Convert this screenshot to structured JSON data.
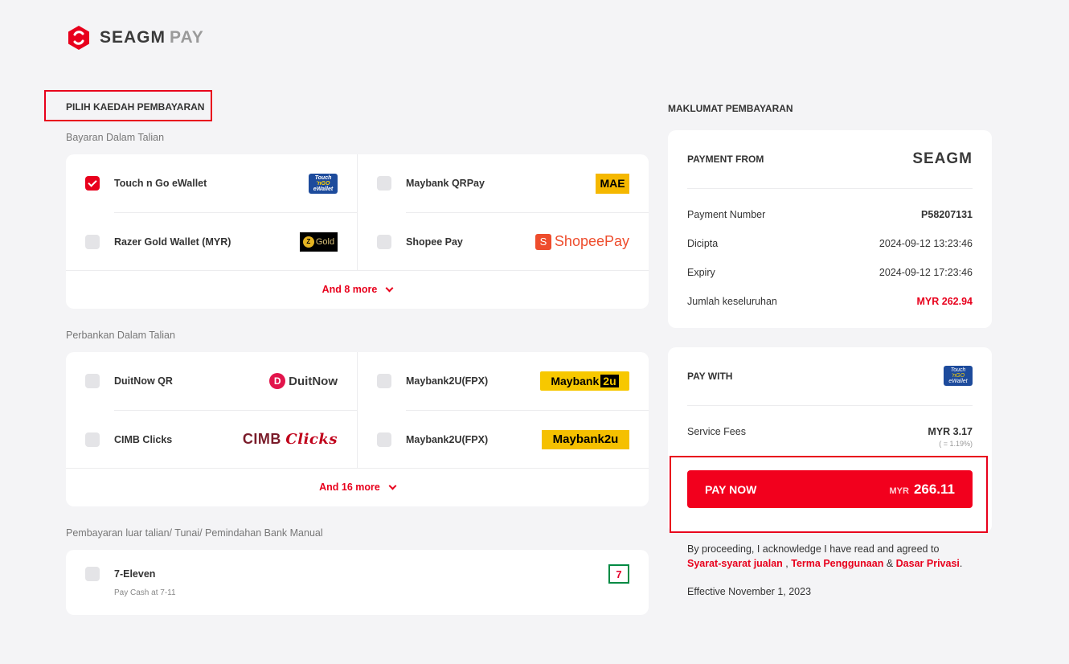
{
  "brand": {
    "name": "SEAGM",
    "suffix": "PAY"
  },
  "left": {
    "title": "PILIH KAEDAH PEMBAYARAN",
    "groups": [
      {
        "label": "Bayaran Dalam Talian",
        "options": [
          {
            "label": "Touch n Go eWallet",
            "checked": true
          },
          {
            "label": "Maybank QRPay",
            "checked": false
          },
          {
            "label": "Razer Gold Wallet (MYR)",
            "checked": false
          },
          {
            "label": "Shopee Pay",
            "checked": false
          }
        ],
        "more": "And 8 more"
      },
      {
        "label": "Perbankan Dalam Talian",
        "options": [
          {
            "label": "DuitNow QR",
            "checked": false
          },
          {
            "label": "Maybank2U(FPX)",
            "checked": false
          },
          {
            "label": "CIMB Clicks",
            "checked": false
          },
          {
            "label": "Maybank2U(FPX)",
            "checked": false
          }
        ],
        "more": "And 16 more"
      },
      {
        "label": "Pembayaran luar talian/ Tunai/ Pemindahan Bank Manual",
        "options": [
          {
            "label": "7-Eleven",
            "sub": "Pay Cash at 7-11",
            "checked": false
          }
        ]
      }
    ],
    "logos": {
      "tng_top": "Touch",
      "tng_mid": "'nGO",
      "tng_bot": "eWallet",
      "razer_coin": "Z",
      "razer_text": "Gold",
      "mae": "MAE",
      "shopee_bag": "S",
      "shopee_text": "ShopeePay",
      "duitnow_d": "D",
      "duitnow_text": "DuitNow",
      "mb2u_a": "Maybank",
      "mb2u_b": "2u",
      "cimb_a": "CIMB",
      "cimb_b": "Clicks",
      "mb2u_plain": "Maybank2u",
      "seven": "7"
    }
  },
  "right": {
    "title": "MAKLUMAT PEMBAYARAN",
    "payment_from": {
      "label": "PAYMENT FROM",
      "merchant": "SEAGM",
      "rows": [
        {
          "label": "Payment Number",
          "value": "P58207131"
        },
        {
          "label": "Dicipta",
          "value": "2024-09-12 13:23:46"
        },
        {
          "label": "Expiry",
          "value": "2024-09-12 17:23:46"
        },
        {
          "label": "Jumlah keseluruhan",
          "value": "MYR 262.94"
        }
      ]
    },
    "pay_with": {
      "label": "PAY WITH",
      "fee_label": "Service Fees",
      "fee_value": "MYR 3.17",
      "fee_pct": "( = 1.19%)"
    },
    "pay_button": {
      "label": "PAY NOW",
      "currency": "MYR",
      "amount": "266.11"
    },
    "legal": {
      "prefix": "By proceeding, I acknowledge I have read and agreed to",
      "link1": "Syarat-syarat jualan",
      "sep1": ",",
      "link2": "Terma Penggunaan",
      "sep2": "&",
      "link3": "Dasar Privasi",
      "end": "."
    },
    "effective": "Effective November 1, 2023"
  },
  "colors": {
    "accent": "#e8001c",
    "background": "#f4f4f6"
  }
}
